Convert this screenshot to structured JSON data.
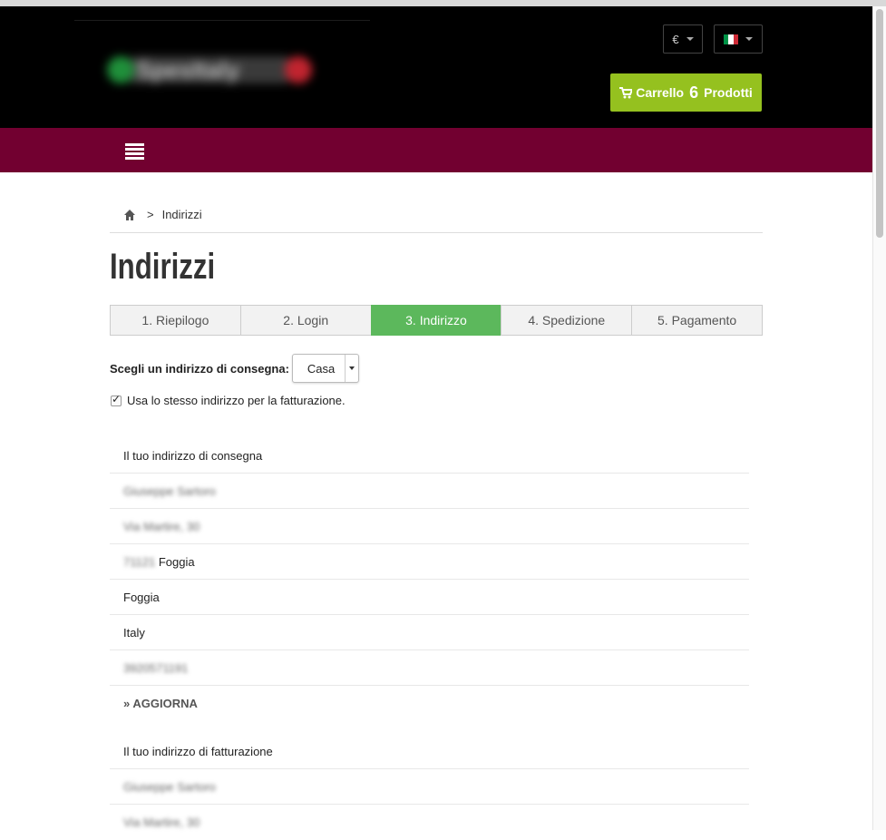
{
  "header": {
    "logo_text": "SpesItaly",
    "currency_label": "€",
    "cart": {
      "label": "Carrello",
      "count": "6",
      "suffix": "Prodotti"
    }
  },
  "breadcrumb": {
    "separator": ">",
    "current": "Indirizzi"
  },
  "page_title": "Indirizzi",
  "steps": [
    {
      "label": "1. Riepilogo",
      "active": false
    },
    {
      "label": "2. Login",
      "active": false
    },
    {
      "label": "3. Indirizzo",
      "active": true
    },
    {
      "label": "4. Spedizione",
      "active": false
    },
    {
      "label": "5. Pagamento",
      "active": false
    }
  ],
  "delivery_select": {
    "label": "Scegli un indirizzo di consegna:",
    "value": "Casa"
  },
  "same_billing": {
    "label": "Usa lo stesso indirizzo per la fatturazione.",
    "checked": true
  },
  "delivery_address": {
    "title": "Il tuo indirizzo di consegna",
    "name": "Giuseppe Sartoro",
    "street": "Via Martire, 30",
    "postcode": "71121",
    "city": "Foggia",
    "province": "Foggia",
    "country": "Italy",
    "phone": "3920571191",
    "update_label": "» AGGIORNA"
  },
  "billing_address": {
    "title": "Il tuo indirizzo di fatturazione",
    "name": "Giuseppe Sartoro",
    "street": "Via Martire, 30"
  },
  "colors": {
    "header_bg": "#000000",
    "nav_bg": "#720030",
    "cart_green": "#95c11f",
    "step_active": "#5cb85c"
  }
}
